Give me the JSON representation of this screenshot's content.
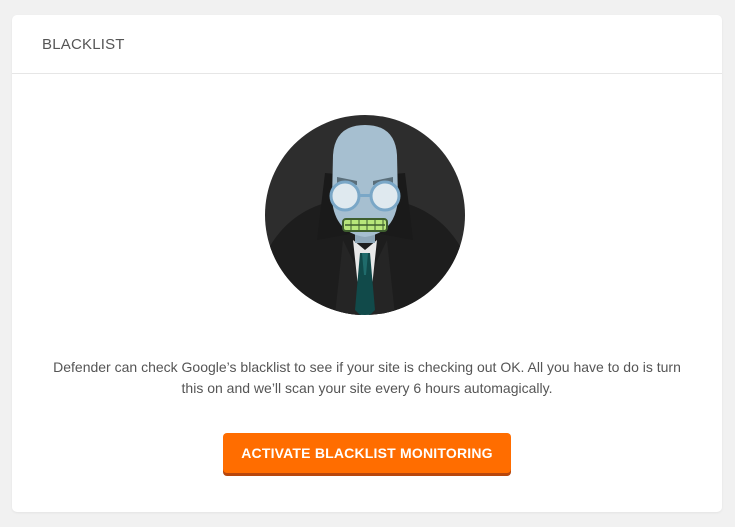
{
  "card": {
    "title": "BLACKLIST"
  },
  "hero": {
    "icon": "hero-defender-icon"
  },
  "description": "Defender can check Google’s blacklist to see if your site is checking out OK. All you have to do is turn this on and we’ll scan your site every 6 hours automagically.",
  "actions": {
    "activate_label": "ACTIVATE BLACKLIST MONITORING"
  },
  "colors": {
    "accent": "#ff6d00",
    "accent_shadow": "#b8470c",
    "text": "#555555",
    "background": "#f1f1f1"
  }
}
